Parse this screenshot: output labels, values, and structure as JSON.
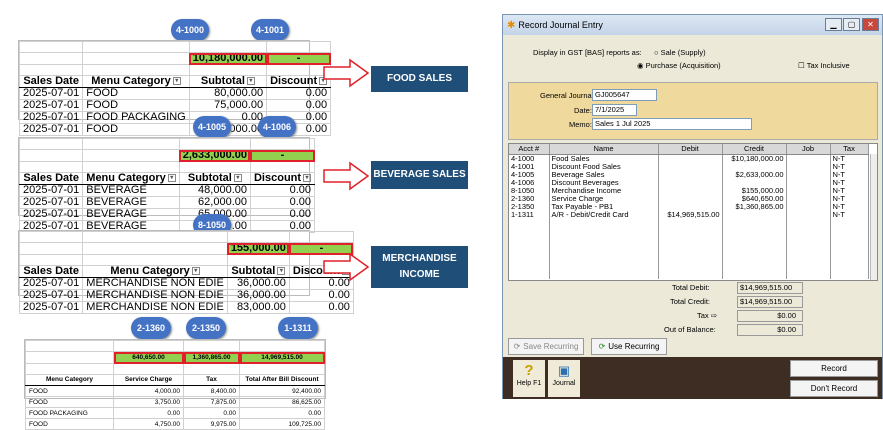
{
  "ovals": {
    "o1": "4-1000",
    "o2": "4-1001",
    "o3": "4-1005",
    "o4": "4-1006",
    "o5": "8-1050",
    "o6": "2-1360",
    "o7": "2-1350",
    "o8": "1-1311"
  },
  "labels": {
    "food": "FOOD SALES",
    "beverage": "BEVERAGE SALES",
    "merch": "MERCHANDISE INCOME"
  },
  "food": {
    "total_subtotal": "10,180,000.00",
    "total_discount": "-",
    "headers": [
      "Sales Date",
      "Menu Category",
      "Subtotal",
      "Discount"
    ],
    "rows": [
      [
        "2025-07-01",
        "FOOD",
        "80,000.00",
        "0.00"
      ],
      [
        "2025-07-01",
        "FOOD",
        "75,000.00",
        "0.00"
      ],
      [
        "2025-07-01",
        "FOOD PACKAGING",
        "0.00",
        "0.00"
      ],
      [
        "2025-07-01",
        "FOOD",
        "95,000.00",
        "0.00"
      ]
    ]
  },
  "beverage": {
    "total_subtotal": "2,633,000.00",
    "total_discount": "-",
    "headers": [
      "Sales Date",
      "Menu Category",
      "Subtotal",
      "Discount"
    ],
    "rows": [
      [
        "2025-07-01",
        "BEVERAGE",
        "48,000.00",
        "0.00"
      ],
      [
        "2025-07-01",
        "BEVERAGE",
        "62,000.00",
        "0.00"
      ],
      [
        "2025-07-01",
        "BEVERAGE",
        "65,000.00",
        "0.00"
      ],
      [
        "2025-07-01",
        "BEVERAGE",
        "36,000.00",
        "0.00"
      ]
    ]
  },
  "merch": {
    "total_subtotal": "155,000.00",
    "total_discount": "-",
    "headers": [
      "Sales Date",
      "Menu Category",
      "Subtotal",
      "Discount"
    ],
    "rows": [
      [
        "2025-07-01",
        "MERCHANDISE NON EDIE",
        "36,000.00",
        "0.00"
      ],
      [
        "2025-07-01",
        "MERCHANDISE NON EDIE",
        "36,000.00",
        "0.00"
      ],
      [
        "2025-07-01",
        "MERCHANDISE NON EDIE",
        "83,000.00",
        "0.00"
      ]
    ]
  },
  "bottom": {
    "totals": [
      "640,650.00",
      "1,360,865.00",
      "14,969,515.00"
    ],
    "headers": [
      "Menu Category",
      "Service Charge",
      "Tax",
      "Total After Bill Discount"
    ],
    "rows": [
      [
        "FOOD",
        "4,000.00",
        "8,400.00",
        "92,400.00"
      ],
      [
        "FOOD",
        "3,750.00",
        "7,875.00",
        "86,625.00"
      ],
      [
        "FOOD PACKAGING",
        "0.00",
        "0.00",
        "0.00"
      ],
      [
        "FOOD",
        "4,750.00",
        "9,975.00",
        "109,725.00"
      ]
    ]
  },
  "window": {
    "title": "Record Journal Entry",
    "display_gst": "Display in GST [BAS] reports as:",
    "opt_sale": "Sale (Supply)",
    "opt_purchase": "Purchase (Acquisition)",
    "tax_inclusive": "Tax Inclusive",
    "gj_label": "General Journal #:",
    "gj_value": "GJ005647",
    "date_label": "Date:",
    "date_value": "7/1/2025",
    "memo_label": "Memo:",
    "memo_value": "Sales 1 Jul 2025",
    "cols": [
      "Acct #",
      "Name",
      "Debit",
      "Credit",
      "Job",
      "Tax"
    ],
    "lines": [
      [
        "4-1000",
        "Food Sales",
        "",
        "$10,180,000.00",
        "",
        "N-T"
      ],
      [
        "4-1001",
        "Discount Food Sales",
        "",
        "",
        "",
        "N-T"
      ],
      [
        "4-1005",
        "Beverage Sales",
        "",
        "$2,633,000.00",
        "",
        "N-T"
      ],
      [
        "4-1006",
        "Discount Beverages",
        "",
        "",
        "",
        "N-T"
      ],
      [
        "8-1050",
        "Merchandise Income",
        "",
        "$155,000.00",
        "",
        "N-T"
      ],
      [
        "2-1360",
        "Service Charge",
        "",
        "$640,650.00",
        "",
        "N-T"
      ],
      [
        "2-1350",
        "Tax Payable - PB1",
        "",
        "$1,360,865.00",
        "",
        "N-T"
      ],
      [
        "1-1311",
        "A/R - Debit/Credit Card",
        "$14,969,515.00",
        "",
        "",
        "N-T"
      ]
    ],
    "total_debit_label": "Total Debit:",
    "total_debit": "$14,969,515.00",
    "total_credit_label": "Total Credit:",
    "total_credit": "$14,969,515.00",
    "tax_label": "Tax",
    "tax_value": "$0.00",
    "oob_label": "Out of Balance:",
    "oob_value": "$0.00",
    "save_recurring": "Save Recurring",
    "use_recurring": "Use Recurring",
    "help": "Help F1",
    "journal": "Journal",
    "record": "Record",
    "dont_record": "Don't Record"
  }
}
